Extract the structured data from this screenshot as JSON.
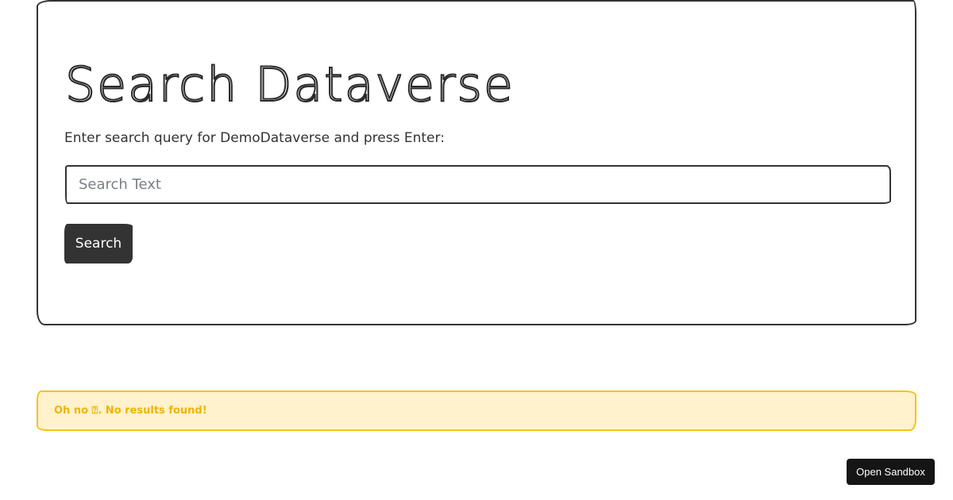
{
  "search_card": {
    "title": "Search Dataverse",
    "description": "Enter search query for DemoDataverse and press Enter:",
    "input_placeholder": "Search Text",
    "input_value": "",
    "button_label": "Search"
  },
  "alert": {
    "message": "Oh no \u0000. No results found!",
    "message_display": "Oh no ⍰. No results found!",
    "color": "#f0b400",
    "background": "#fff2cc"
  },
  "sandbox_button": {
    "label": "Open Sandbox"
  },
  "colors": {
    "ink": "#333333",
    "alert_border": "#f7c21a",
    "sandbox_bg": "#151515"
  }
}
